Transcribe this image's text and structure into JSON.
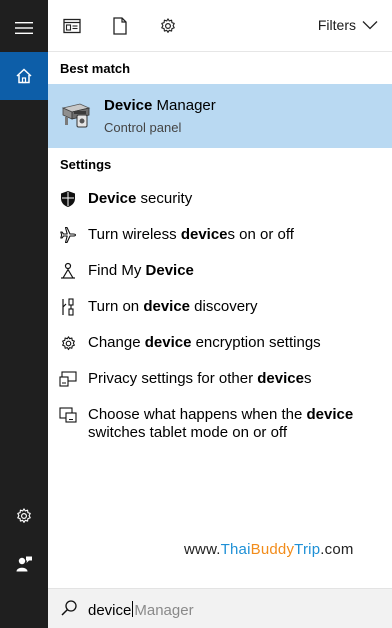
{
  "toolbar": {
    "filters_label": "Filters"
  },
  "best_match": {
    "heading": "Best match",
    "title_bold": "Device",
    "title_rest": " Manager",
    "subtitle": "Control panel"
  },
  "settings": {
    "heading": "Settings",
    "items": [
      {
        "icon": "shield-icon",
        "pre": "",
        "bold": "Device",
        "post": " security"
      },
      {
        "icon": "airplane-icon",
        "pre": "Turn wireless ",
        "bold": "device",
        "post": "s on or off"
      },
      {
        "icon": "person-locate-icon",
        "pre": "Find My ",
        "bold": "Device",
        "post": ""
      },
      {
        "icon": "discovery-icon",
        "pre": "Turn on ",
        "bold": "device",
        "post": " discovery"
      },
      {
        "icon": "gear-icon",
        "pre": "Change ",
        "bold": "device",
        "post": " encryption settings"
      },
      {
        "icon": "devices-icon",
        "pre": "Privacy settings for other ",
        "bold": "device",
        "post": "s"
      },
      {
        "icon": "tablet-mode-icon",
        "pre": "Choose what happens when the ",
        "bold": "device",
        "post": "",
        "line2": "switches tablet mode on or off"
      }
    ]
  },
  "watermark": {
    "prefix": "www.",
    "thai": "Thai",
    "buddy": "Buddy",
    "trip": "Trip",
    "suffix": ".com"
  },
  "search": {
    "typed": "device",
    "suggestion": "Manager"
  },
  "colors": {
    "sidebar_bg": "#1f1f1f",
    "home_active": "#0d5ea8",
    "selected_row": "#b9d9f2"
  }
}
